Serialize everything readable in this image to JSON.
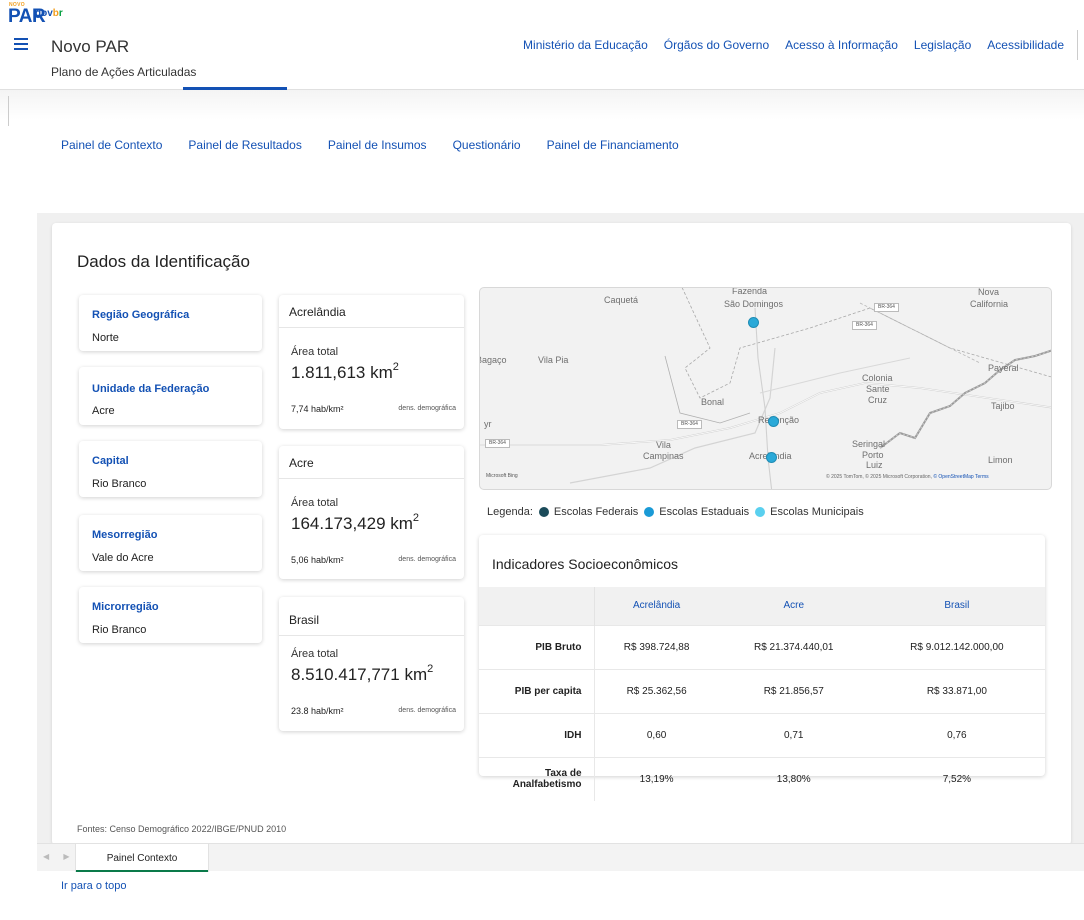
{
  "brand": {
    "novo": "NOVO",
    "par": "PAR",
    "govbr_g": "g",
    "govbr_o": "o",
    "govbr_v": "v",
    "govbr_b": "b",
    "govbr_r": "r"
  },
  "header": {
    "title": "Novo PAR",
    "subtitle": "Plano de Ações Articuladas",
    "links": [
      "Ministério da Educação",
      "Órgãos do Governo",
      "Acesso à Informação",
      "Legislação",
      "Acessibilidade"
    ]
  },
  "subnav": [
    "Painel de Contexto",
    "Painel de Resultados",
    "Painel de Insumos",
    "Questionário",
    "Painel de Financiamento"
  ],
  "section_title": "Dados da Identificação",
  "id_cards": [
    {
      "label": "Região Geográfica",
      "value": "Norte"
    },
    {
      "label": "Unidade da Federação",
      "value": "Acre"
    },
    {
      "label": "Capital",
      "value": "Rio Branco"
    },
    {
      "label": "Mesorregião",
      "value": "Vale do Acre"
    },
    {
      "label": "Microrregião",
      "value": "Rio Branco"
    }
  ],
  "area_cards": [
    {
      "name": "Acrelândia",
      "area_label": "Área total",
      "area": "1.811,613 km",
      "unit_sup": "2",
      "density": "7,74 hab/km²",
      "density_label": "dens. demográfica"
    },
    {
      "name": "Acre",
      "area_label": "Área total",
      "area": "164.173,429 km",
      "unit_sup": "2",
      "density": "5,06 hab/km²",
      "density_label": "dens. demográfica"
    },
    {
      "name": "Brasil",
      "area_label": "Área total",
      "area": "8.510.417,771 km",
      "unit_sup": "2",
      "density": "23.8 hab/km²",
      "density_label": "dens. demográfica"
    }
  ],
  "map": {
    "labels": [
      "Caquetá",
      "Fazenda",
      "São Domingos",
      "California",
      "Nova",
      "Bagaço",
      "Vila Pia",
      "Payeral",
      "Colonia",
      "Sante",
      "Cruz",
      "Tajibo",
      "Bonal",
      "Redenção",
      "Vila",
      "Campinas",
      "Acrelândia",
      "Seringal",
      "Porto",
      "Luiz",
      "Limon",
      "yr"
    ],
    "shields": [
      "BR-364",
      "BR-364",
      "BR-364",
      "BR-364"
    ],
    "attribution_prefix": "© 2025 TomTom, © 2025 Microsoft Corporation, ",
    "attribution_link": "© OpenStreetMap",
    "attribution_terms": "Terms",
    "provider": "Microsoft Bing"
  },
  "legend": {
    "title": "Legenda:",
    "items": [
      {
        "label": "Escolas Federais",
        "color": "#1b4b5a"
      },
      {
        "label": "Escolas Estaduais",
        "color": "#1a9ad6"
      },
      {
        "label": "Escolas Municipais",
        "color": "#5ad0ef"
      }
    ]
  },
  "indicators": {
    "title": "Indicadores Socioeconômicos",
    "columns": [
      "Acrelândia",
      "Acre",
      "Brasil"
    ],
    "rows": [
      {
        "label": "PIB Bruto",
        "values": [
          "R$ 398.724,88",
          "R$ 21.374.440,01",
          "R$ 9.012.142.000,00"
        ]
      },
      {
        "label": "PIB per capita",
        "values": [
          "R$ 25.362,56",
          "R$ 21.856,57",
          "R$ 33.871,00"
        ]
      },
      {
        "label": "IDH",
        "values": [
          "0,60",
          "0,71",
          "0,76"
        ]
      },
      {
        "label": "Taxa de Analfabetismo",
        "values": [
          "13,19%",
          "13,80%",
          "7,52%"
        ]
      }
    ]
  },
  "source": "Fontes: Censo Demográfico 2022/IBGE/PNUD 2010",
  "bottom_tab": "Painel Contexto",
  "to_top": "Ir para o topo"
}
